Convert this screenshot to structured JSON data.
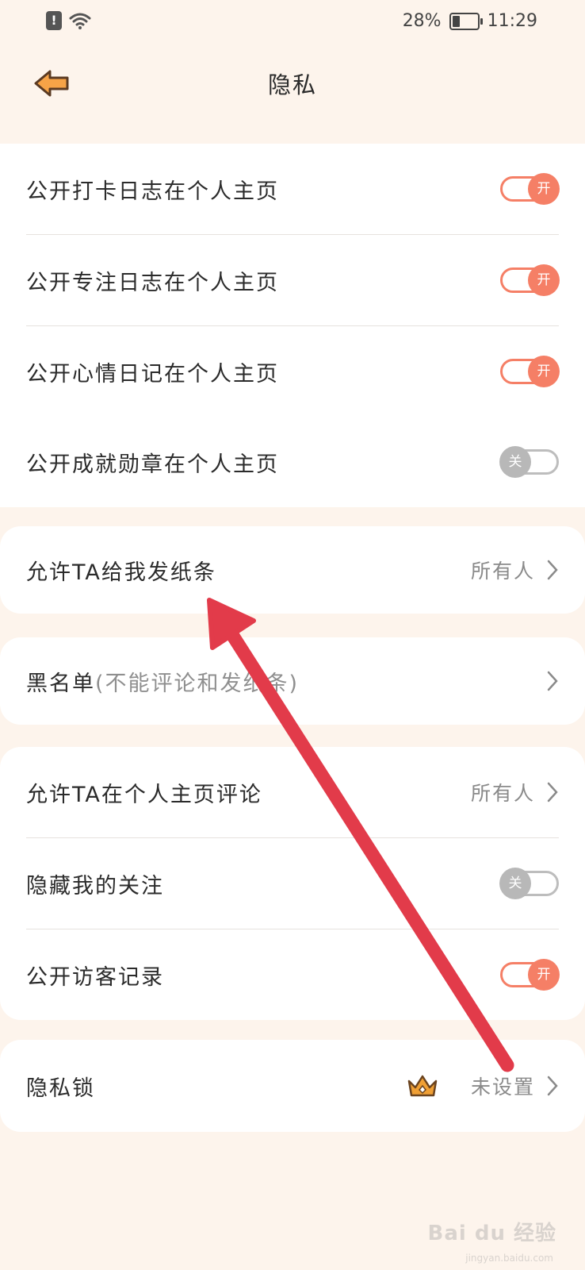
{
  "status_bar": {
    "battery": "28%",
    "time": "11:29"
  },
  "header": {
    "title": "隐私"
  },
  "section1": [
    {
      "label": "公开打卡日志在个人主页",
      "toggle": "开",
      "on": true
    },
    {
      "label": "公开专注日志在个人主页",
      "toggle": "开",
      "on": true
    },
    {
      "label": "公开心情日记在个人主页",
      "toggle": "开",
      "on": true
    },
    {
      "label": "公开成就勋章在个人主页",
      "toggle": "关",
      "on": false
    }
  ],
  "section2": {
    "label": "允许TA给我发纸条",
    "value": "所有人"
  },
  "section3": {
    "label": "黑名单",
    "hint": "(不能评论和发纸条)"
  },
  "section4": {
    "comment": {
      "label": "允许TA在个人主页评论",
      "value": "所有人"
    },
    "hide_follow": {
      "label": "隐藏我的关注",
      "toggle": "关",
      "on": false
    },
    "visitors": {
      "label": "公开访客记录",
      "toggle": "开",
      "on": true
    }
  },
  "section5": {
    "label": "隐私锁",
    "value": "未设置"
  },
  "watermark": {
    "text": "Bai du 经验",
    "sub": "jingyan.baidu.com"
  },
  "colors": {
    "accent": "#f57f66",
    "background": "#fdf4ec",
    "annotation_arrow": "#e23b4a",
    "crown": "#f0a035"
  }
}
